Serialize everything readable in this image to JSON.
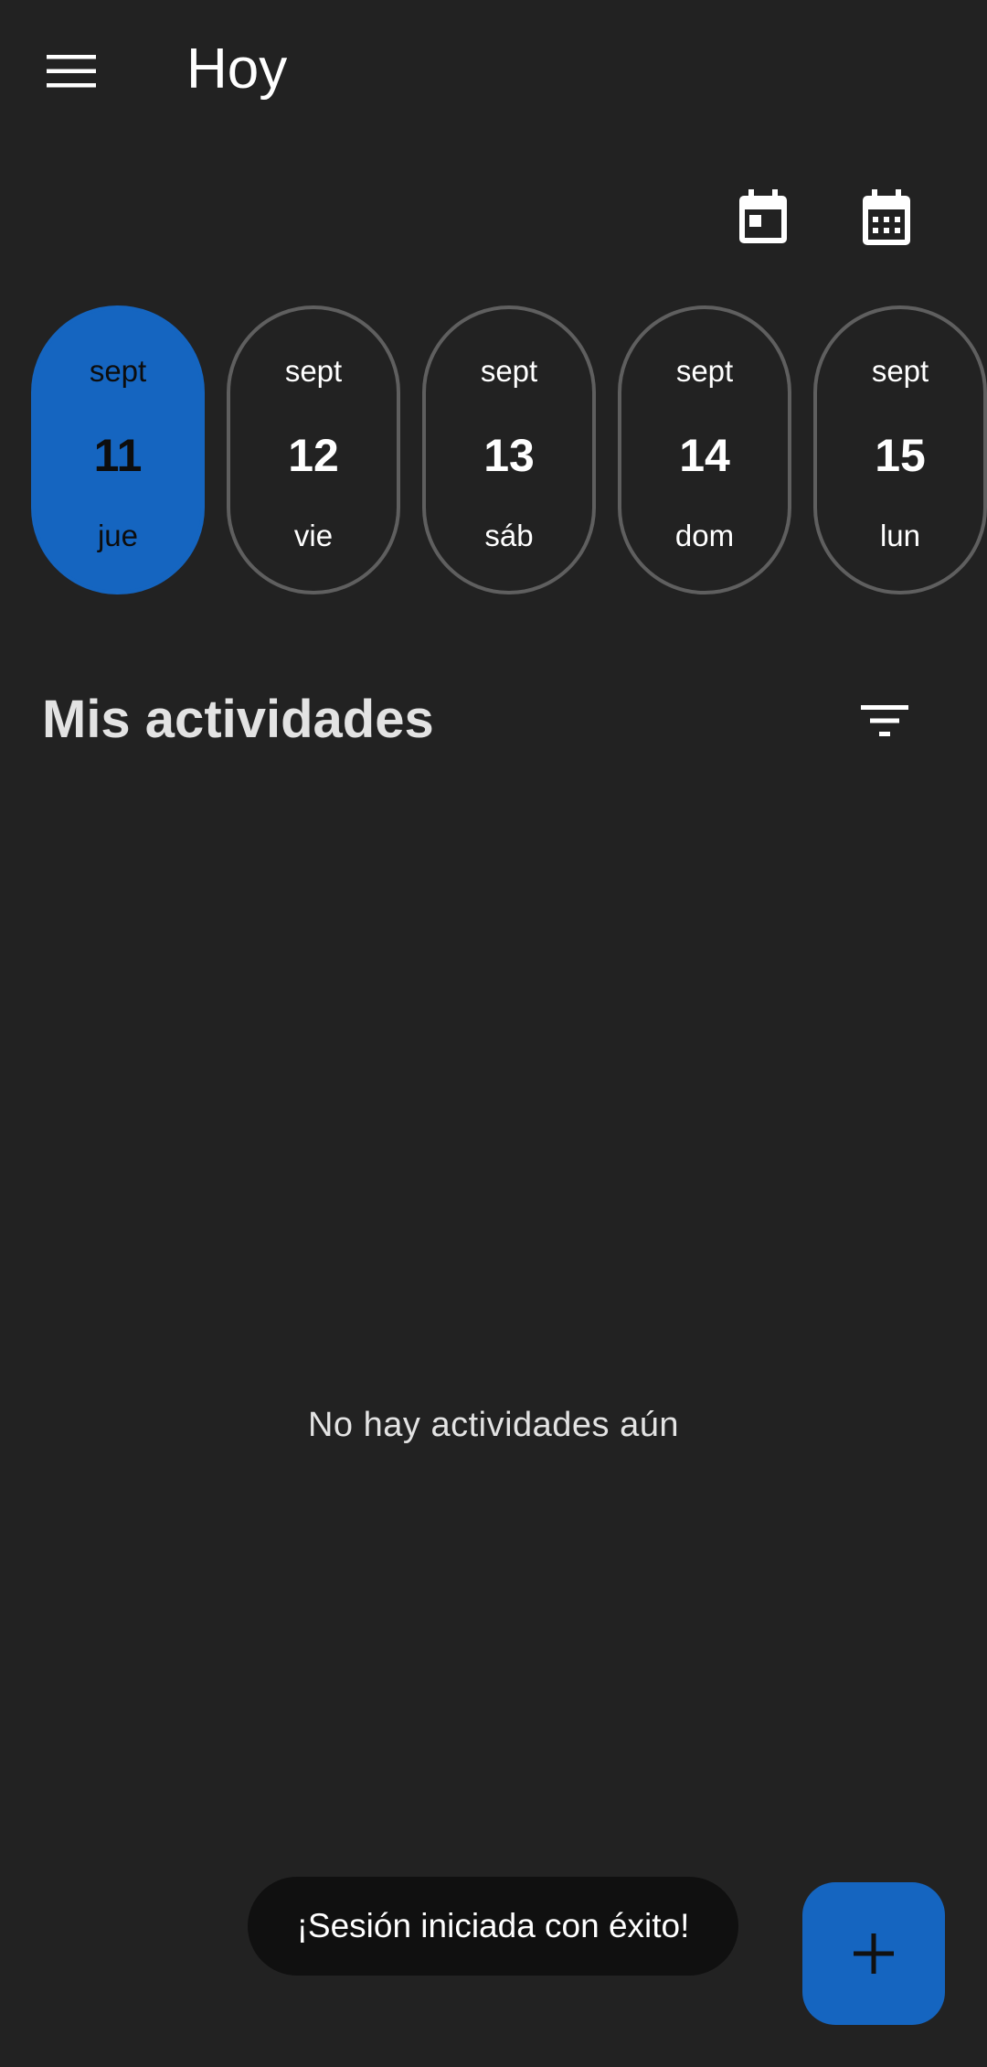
{
  "app_bar": {
    "title": "Hoy",
    "menu_icon": "menu-icon",
    "actions": [
      {
        "name": "today-calendar-icon"
      },
      {
        "name": "month-calendar-icon"
      }
    ]
  },
  "day_strip": {
    "days": [
      {
        "month": "sept",
        "day": "11",
        "weekday": "jue",
        "selected": true
      },
      {
        "month": "sept",
        "day": "12",
        "weekday": "vie",
        "selected": false
      },
      {
        "month": "sept",
        "day": "13",
        "weekday": "sáb",
        "selected": false
      },
      {
        "month": "sept",
        "day": "14",
        "weekday": "dom",
        "selected": false
      },
      {
        "month": "sept",
        "day": "15",
        "weekday": "lun",
        "selected": false
      }
    ]
  },
  "activities": {
    "title": "Mis actividades",
    "filter_icon": "filter-icon",
    "empty_message": "No hay actividades aún"
  },
  "snackbar": {
    "message": "¡Sesión iniciada con éxito!"
  },
  "fab": {
    "icon": "add-icon"
  },
  "colors": {
    "background": "#222222",
    "accent": "#1565c0",
    "chip_border": "#5f5f5f",
    "snackbar": "#101010"
  }
}
